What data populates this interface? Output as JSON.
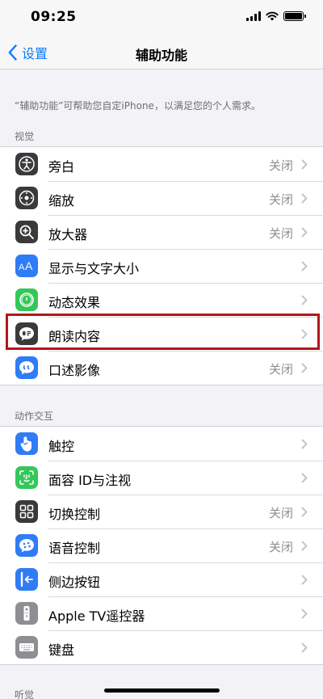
{
  "status_bar": {
    "time": "09:25"
  },
  "nav": {
    "back_label": "设置",
    "title": "辅助功能"
  },
  "intro": "“辅助功能”可帮助您自定iPhone，以满足您的个人需求。",
  "sections": [
    {
      "header": "视觉",
      "items": [
        {
          "label": "旁白",
          "value": "关闭",
          "icon": "voiceover-icon",
          "color": "#3a3a3c"
        },
        {
          "label": "缩放",
          "value": "关闭",
          "icon": "zoom-icon",
          "color": "#3a3a3c"
        },
        {
          "label": "放大器",
          "value": "关闭",
          "icon": "magnifier-icon",
          "color": "#3a3a3c"
        },
        {
          "label": "显示与文字大小",
          "value": "",
          "icon": "text-size-icon",
          "color": "#2f7cf6"
        },
        {
          "label": "动态效果",
          "value": "",
          "icon": "motion-icon",
          "color": "#34c759"
        },
        {
          "label": "朗读内容",
          "value": "",
          "icon": "spoken-content-icon",
          "color": "#3a3a3c"
        },
        {
          "label": "口述影像",
          "value": "关闭",
          "icon": "audio-description-icon",
          "color": "#2f7cf6"
        }
      ]
    },
    {
      "header": "动作交互",
      "items": [
        {
          "label": "触控",
          "value": "",
          "icon": "touch-icon",
          "color": "#2f7cf6"
        },
        {
          "label": "面容 ID与注视",
          "value": "",
          "icon": "face-id-icon",
          "color": "#34c759"
        },
        {
          "label": "切换控制",
          "value": "关闭",
          "icon": "switch-control-icon",
          "color": "#3a3a3c"
        },
        {
          "label": "语音控制",
          "value": "关闭",
          "icon": "voice-control-icon",
          "color": "#2f7cf6"
        },
        {
          "label": "侧边按钮",
          "value": "",
          "icon": "side-button-icon",
          "color": "#2f7cf6"
        },
        {
          "label": "Apple TV遥控器",
          "value": "",
          "icon": "tv-remote-icon",
          "color": "#8e8e93"
        },
        {
          "label": "键盘",
          "value": "",
          "icon": "keyboard-icon",
          "color": "#8e8e93"
        }
      ]
    },
    {
      "header": "听觉",
      "items": []
    }
  ],
  "highlight_color": "#b3161a"
}
